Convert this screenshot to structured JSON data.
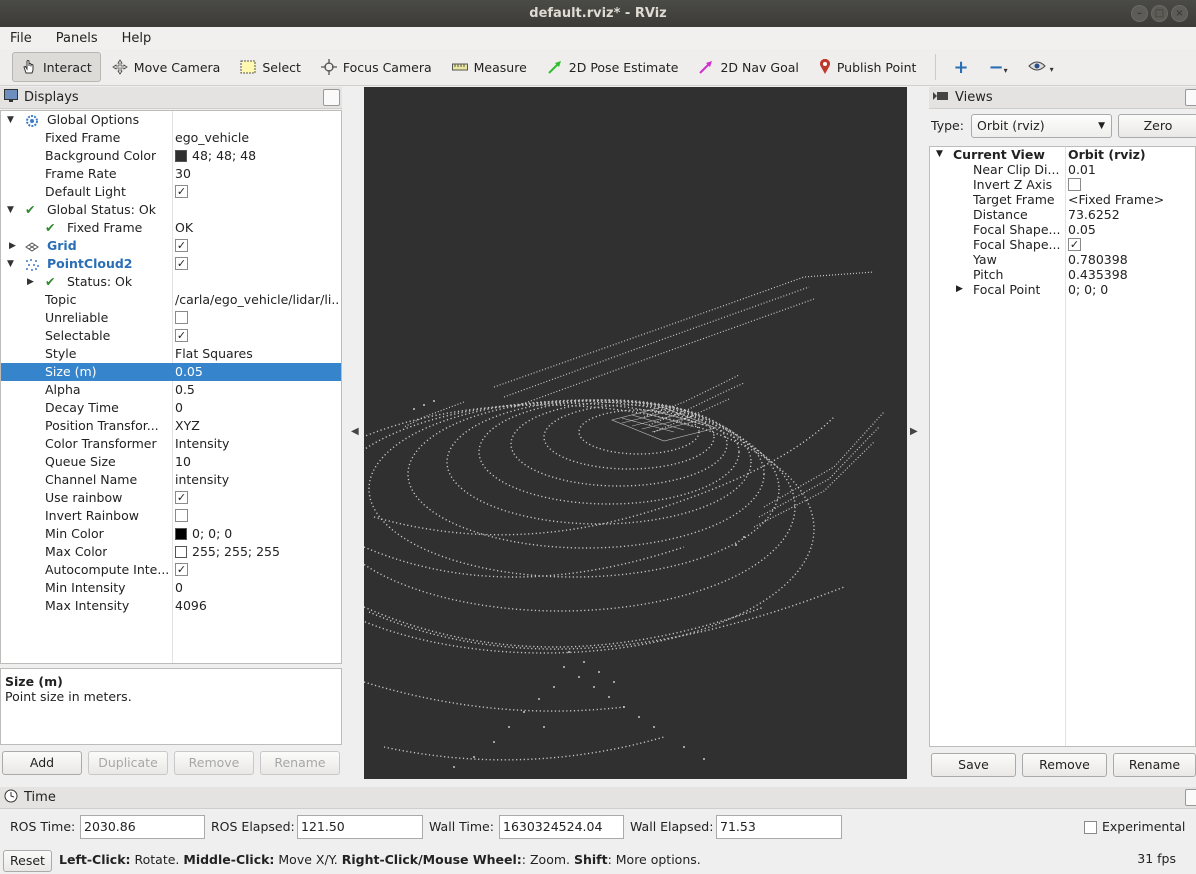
{
  "window": {
    "title": "default.rviz* - RViz"
  },
  "menu": [
    "File",
    "Panels",
    "Help"
  ],
  "toolbar": {
    "tools": [
      {
        "label": "Interact",
        "icon": "hand-icon"
      },
      {
        "label": "Move Camera",
        "icon": "move-camera-icon"
      },
      {
        "label": "Select",
        "icon": "select-icon"
      },
      {
        "label": "Focus Camera",
        "icon": "focus-camera-icon"
      },
      {
        "label": "Measure",
        "icon": "ruler-icon"
      },
      {
        "label": "2D Pose Estimate",
        "icon": "green-arrow-icon"
      },
      {
        "label": "2D Nav Goal",
        "icon": "magenta-arrow-icon"
      },
      {
        "label": "Publish Point",
        "icon": "map-pin-icon"
      }
    ]
  },
  "displays": {
    "title": "Displays",
    "rows": [
      {
        "name": "Global Options",
        "value": ""
      },
      {
        "name": "Fixed Frame",
        "value": "ego_vehicle"
      },
      {
        "name": "Background Color",
        "value": "48; 48; 48"
      },
      {
        "name": "Frame Rate",
        "value": "30"
      },
      {
        "name": "Default Light",
        "value": ""
      },
      {
        "name": "Global Status: Ok",
        "value": ""
      },
      {
        "name": "Fixed Frame",
        "value": "OK"
      },
      {
        "name": "Grid",
        "value": ""
      },
      {
        "name": "PointCloud2",
        "value": ""
      },
      {
        "name": "Status: Ok",
        "value": ""
      },
      {
        "name": "Topic",
        "value": "/carla/ego_vehicle/lidar/li..."
      },
      {
        "name": "Unreliable",
        "value": ""
      },
      {
        "name": "Selectable",
        "value": ""
      },
      {
        "name": "Style",
        "value": "Flat Squares"
      },
      {
        "name": "Size (m)",
        "value": "0.05"
      },
      {
        "name": "Alpha",
        "value": "0.5"
      },
      {
        "name": "Decay Time",
        "value": "0"
      },
      {
        "name": "Position Transfor...",
        "value": "XYZ"
      },
      {
        "name": "Color Transformer",
        "value": "Intensity"
      },
      {
        "name": "Queue Size",
        "value": "10"
      },
      {
        "name": "Channel Name",
        "value": "intensity"
      },
      {
        "name": "Use rainbow",
        "value": ""
      },
      {
        "name": "Invert Rainbow",
        "value": ""
      },
      {
        "name": "Min Color",
        "value": "0; 0; 0"
      },
      {
        "name": "Max Color",
        "value": "255; 255; 255"
      },
      {
        "name": "Autocompute Inte...",
        "value": ""
      },
      {
        "name": "Min Intensity",
        "value": "0"
      },
      {
        "name": "Max Intensity",
        "value": "4096"
      }
    ],
    "description": {
      "title": "Size (m)",
      "text": "Point size in meters."
    },
    "buttons": [
      "Add",
      "Duplicate",
      "Remove",
      "Rename"
    ]
  },
  "views": {
    "title": "Views",
    "type_label": "Type:",
    "type_value": "Orbit (rviz)",
    "zero_label": "Zero",
    "rows": [
      {
        "name": "Current View",
        "value": "Orbit (rviz)"
      },
      {
        "name": "Near Clip Di...",
        "value": "0.01"
      },
      {
        "name": "Invert Z Axis",
        "value": ""
      },
      {
        "name": "Target Frame",
        "value": "<Fixed Frame>"
      },
      {
        "name": "Distance",
        "value": "73.6252"
      },
      {
        "name": "Focal Shape...",
        "value": "0.05"
      },
      {
        "name": "Focal Shape...",
        "value": ""
      },
      {
        "name": "Yaw",
        "value": "0.780398"
      },
      {
        "name": "Pitch",
        "value": "0.435398"
      },
      {
        "name": "Focal Point",
        "value": "0; 0; 0"
      }
    ],
    "buttons": [
      "Save",
      "Remove",
      "Rename"
    ]
  },
  "time": {
    "title": "Time",
    "ros_time_label": "ROS Time:",
    "ros_time": "2030.86",
    "ros_elapsed_label": "ROS Elapsed:",
    "ros_elapsed": "121.50",
    "wall_time_label": "Wall Time:",
    "wall_time": "1630324524.04",
    "wall_elapsed_label": "Wall Elapsed:",
    "wall_elapsed": "71.53",
    "experimental_label": "Experimental"
  },
  "status": {
    "reset_label": "Reset",
    "help_b1": "Left-Click:",
    "help_t1": " Rotate. ",
    "help_b2": "Middle-Click:",
    "help_t2": " Move X/Y. ",
    "help_b3": "Right-Click/Mouse Wheel:",
    "help_t3": ": Zoom. ",
    "help_b4": "Shift",
    "help_t4": ": More options.",
    "fps": "31 fps"
  },
  "colors": {
    "viewport_bg": "#303030",
    "selection": "#3584cc",
    "title_bar": "#3c3b37"
  }
}
